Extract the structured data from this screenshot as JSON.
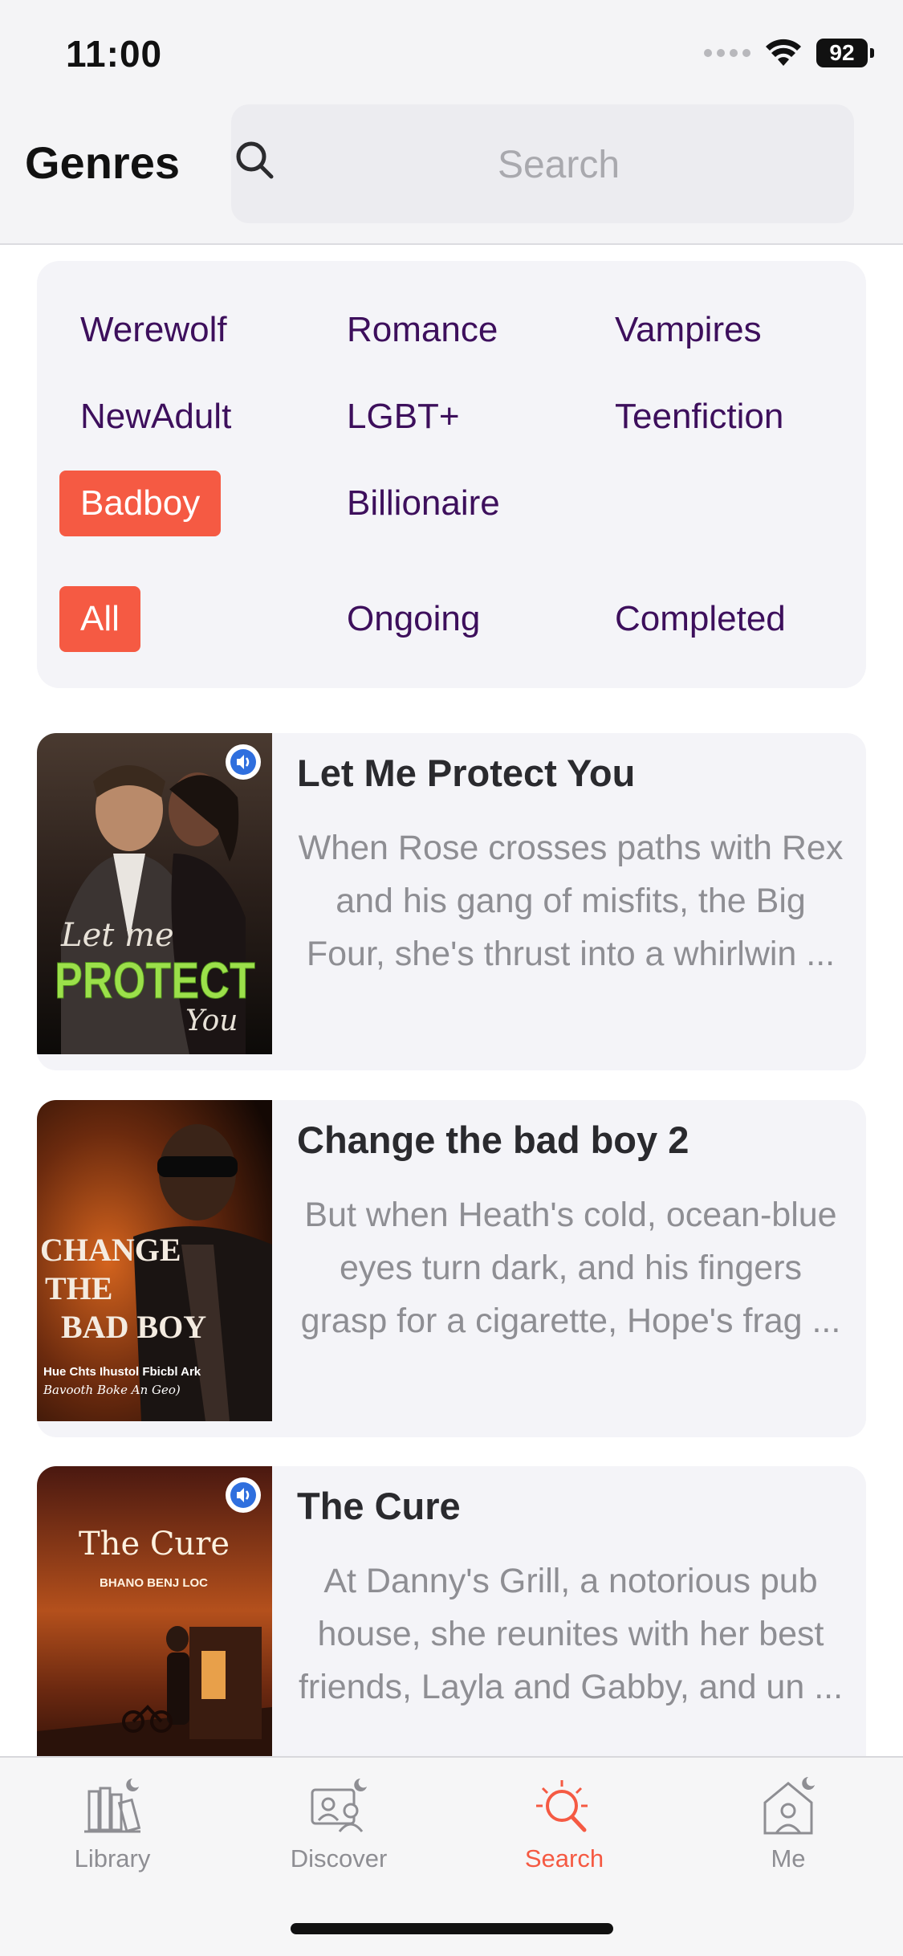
{
  "status_bar": {
    "time": "11:00",
    "battery": "92",
    "icons": [
      "cellular-signal-icon",
      "wifi-icon",
      "battery-icon"
    ]
  },
  "header": {
    "title": "Genres",
    "search": {
      "placeholder": "Search",
      "icon": "search-icon"
    }
  },
  "genres": {
    "categories": [
      "Werewolf",
      "Romance",
      "Vampires",
      "NewAdult",
      "LGBT+",
      "Teenfiction",
      "Badboy",
      "Billionaire"
    ],
    "selected_category": "Badboy",
    "status_filters": [
      "All",
      "Ongoing",
      "Completed"
    ],
    "selected_status": "All"
  },
  "books": [
    {
      "title": "Let Me Protect You",
      "description": "When Rose crosses paths with Rex and his gang of misfits, the Big Four, she's thrust into a whirlwin ...",
      "cover_text": [
        "Let me",
        "PROTECT",
        "You"
      ],
      "audio": true
    },
    {
      "title": "Change the bad boy 2",
      "description": "But when Heath's cold, ocean-blue eyes turn dark, and his fingers grasp for a cigarette, Hope's frag ...",
      "cover_text": [
        "CHANGE",
        "THE",
        "BAD BOY",
        "Hue Chts Ihustol Fbicbl Ark",
        "Bavooth Boke An Geo)"
      ],
      "audio": false
    },
    {
      "title": "The Cure",
      "description": "At Danny's Grill, a notorious pub house, she reunites with her best friends, Layla and Gabby, and un ...",
      "cover_text": [
        "The Cure",
        "BHANO BENJ LOC"
      ],
      "audio": true
    }
  ],
  "tab_bar": {
    "tabs": [
      {
        "label": "Library",
        "icon": "library-icon"
      },
      {
        "label": "Discover",
        "icon": "discover-icon"
      },
      {
        "label": "Search",
        "icon": "search-tab-icon"
      },
      {
        "label": "Me",
        "icon": "profile-icon"
      }
    ],
    "active": "Search"
  },
  "colors": {
    "accent": "#f55a43",
    "genre_text": "#3d0f5c",
    "panel_bg": "#f4f4f8",
    "muted_text": "#8e8e93"
  }
}
